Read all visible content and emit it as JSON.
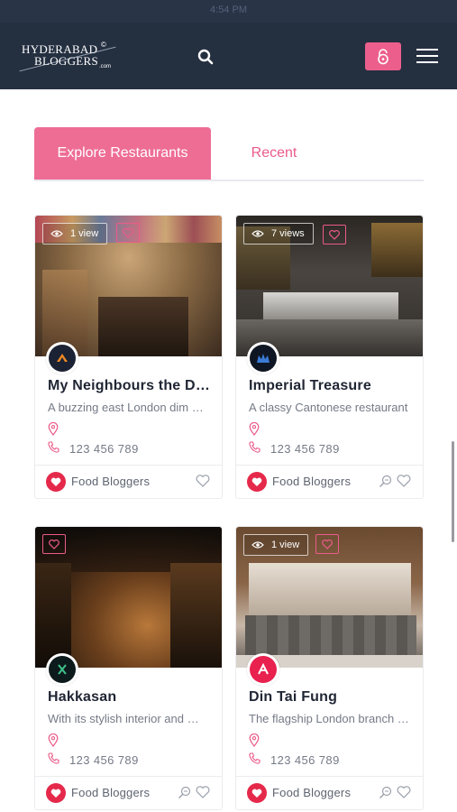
{
  "status_bar": {
    "time": "4:54 PM"
  },
  "header": {
    "logo_line1": "HYDERABAD",
    "logo_line2": "BLOGGERS",
    "logo_suffix": ".com",
    "icons": [
      "search-icon",
      "lock-icon",
      "menu-icon"
    ],
    "accent_color": "#ec5f8c",
    "background_color": "#242f40"
  },
  "tabs": [
    {
      "label": "Explore Restaurants",
      "active": true
    },
    {
      "label": "Recent",
      "active": false
    }
  ],
  "listings": [
    {
      "views": "1 view",
      "title": "My Neighbours the Dumplings",
      "description": "A buzzing east London dim sum restaurant",
      "phone": "123 456 789",
      "author": "Food Bloggers"
    },
    {
      "views": "7 views",
      "title": "Imperial Treasure",
      "description": "A classy Cantonese restaurant",
      "phone": "123 456 789",
      "author": "Food Bloggers"
    },
    {
      "views": "",
      "title": "Hakkasan",
      "description": "With its stylish interior and modern cuisine",
      "phone": "123 456 789",
      "author": "Food Bloggers"
    },
    {
      "views": "1 view",
      "title": "Din Tai Fung",
      "description": "The flagship London branch of the famous chain",
      "phone": "123 456 789",
      "author": "Food Bloggers"
    }
  ]
}
